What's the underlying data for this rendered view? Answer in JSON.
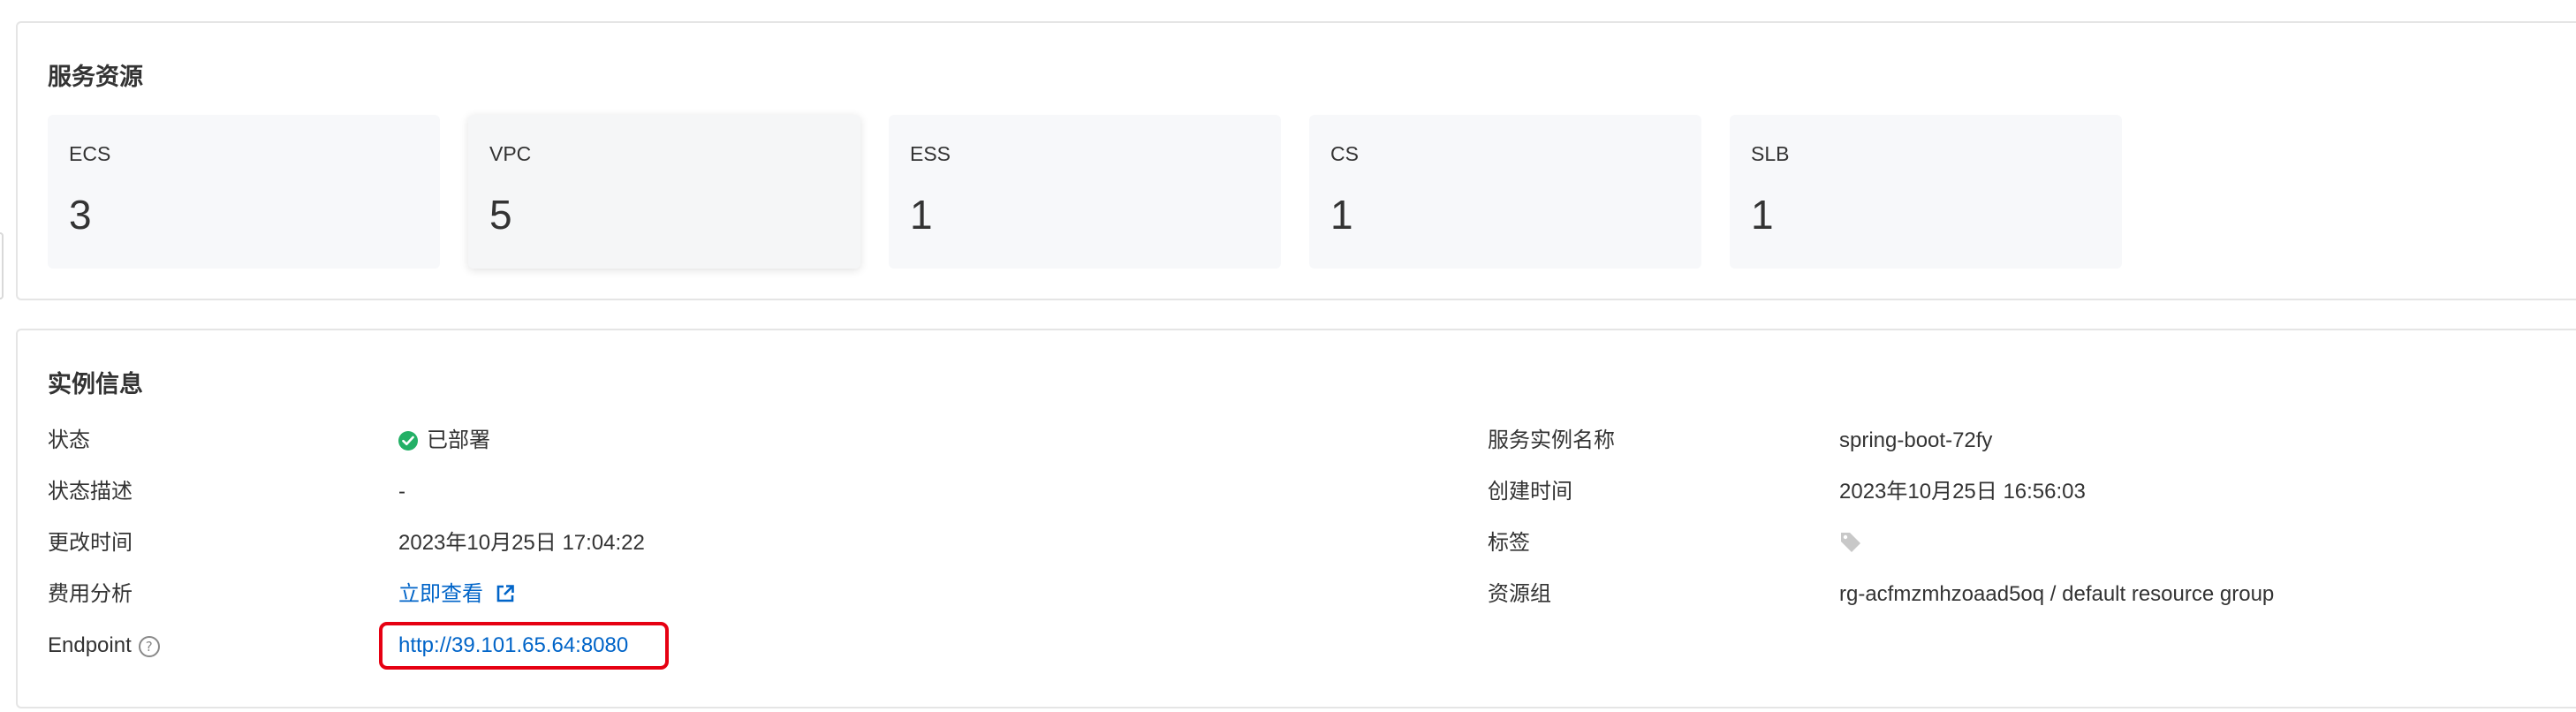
{
  "resources": {
    "title": "服务资源",
    "cards": [
      {
        "label": "ECS",
        "value": "3"
      },
      {
        "label": "VPC",
        "value": "5"
      },
      {
        "label": "ESS",
        "value": "1"
      },
      {
        "label": "CS",
        "value": "1"
      },
      {
        "label": "SLB",
        "value": "1"
      }
    ]
  },
  "instance": {
    "title": "实例信息",
    "left": {
      "status_label": "状态",
      "status_value": "已部署",
      "status_desc_label": "状态描述",
      "status_desc_value": "-",
      "modified_label": "更改时间",
      "modified_value": "2023年10月25日 17:04:22",
      "cost_label": "费用分析",
      "cost_link": "立即查看",
      "endpoint_label": "Endpoint",
      "endpoint_value": "http://39.101.65.64:8080"
    },
    "right": {
      "name_label": "服务实例名称",
      "name_value": "spring-boot-72fy",
      "created_label": "创建时间",
      "created_value": "2023年10月25日 16:56:03",
      "tags_label": "标签",
      "rg_label": "资源组",
      "rg_value": "rg-acfmzmhzoaad5oq / default resource group"
    }
  },
  "colors": {
    "link": "#0064c8",
    "status_success": "#23b066",
    "highlight_border": "#e60012"
  },
  "icons": {
    "status": "check-circle-icon",
    "external": "external-link-icon",
    "help": "help-circle-icon",
    "tag": "tag-icon"
  }
}
